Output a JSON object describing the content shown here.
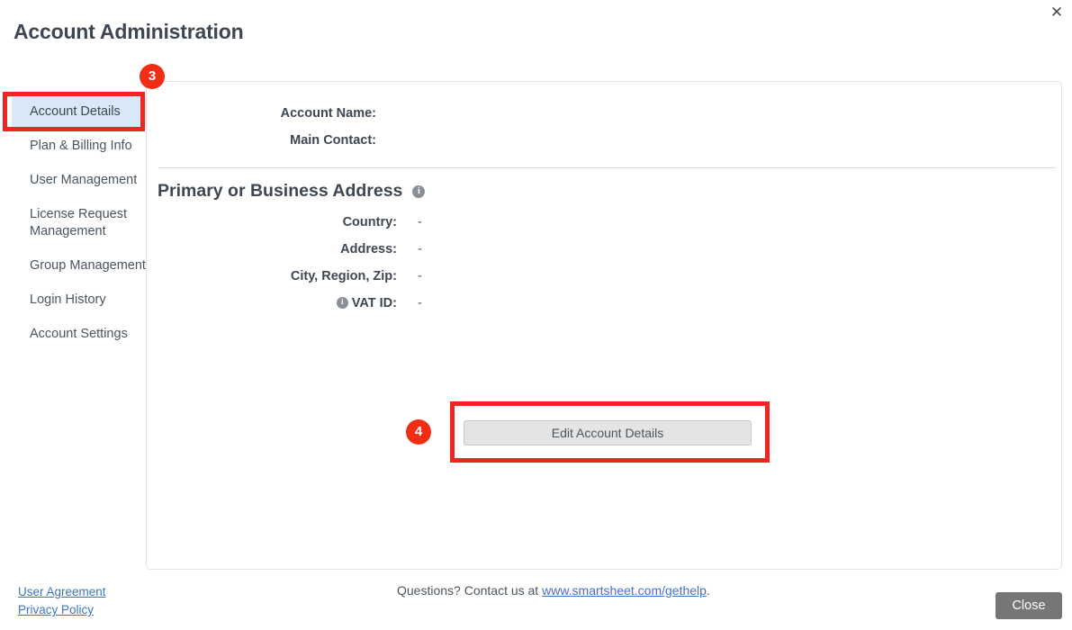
{
  "header": {
    "title": "Account Administration",
    "close_icon": "close-icon",
    "close_glyph": "✕"
  },
  "sidebar": {
    "items": [
      {
        "label": "Account Details",
        "active": true
      },
      {
        "label": "Plan & Billing Info",
        "active": false
      },
      {
        "label": "User Management",
        "active": false
      },
      {
        "label": "License Request Management",
        "active": false
      },
      {
        "label": "Group Management",
        "active": false
      },
      {
        "label": "Login History",
        "active": false
      },
      {
        "label": "Account Settings",
        "active": false
      }
    ]
  },
  "main": {
    "account_name_label": "Account Name:",
    "account_name_value": "",
    "main_contact_label": "Main Contact:",
    "main_contact_value": "",
    "section_heading": "Primary or Business Address",
    "section_heading_info_icon": "info-icon",
    "fields": [
      {
        "label": "Country:",
        "value": "-"
      },
      {
        "label": "Address:",
        "value": "-"
      },
      {
        "label": "City, Region, Zip:",
        "value": "-"
      }
    ],
    "vat": {
      "info_icon": "info-icon",
      "label": "VAT ID:",
      "value": "-"
    },
    "edit_button_label": "Edit Account Details"
  },
  "annotations": {
    "badge_sidebar": "3",
    "badge_button": "4",
    "highlight_color": "#ee2722",
    "badge_color": "#f22d16"
  },
  "footer": {
    "user_agreement": "User Agreement",
    "privacy_policy": "Privacy Policy",
    "contact_prefix": "Questions? Contact us at ",
    "contact_link": "www.smartsheet.com/gethelp",
    "contact_suffix": ".",
    "close_label": "Close"
  }
}
